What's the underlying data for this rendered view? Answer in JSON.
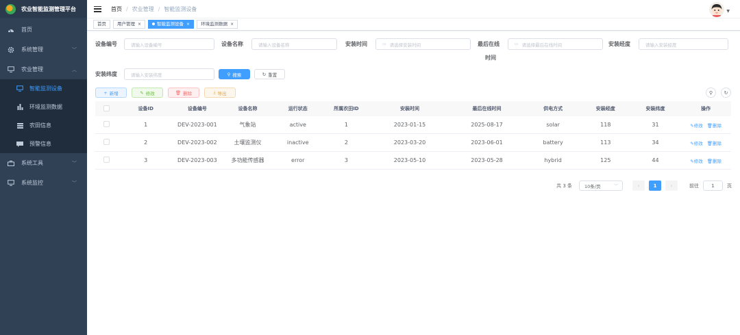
{
  "app": {
    "title": "农业智能监测管理平台"
  },
  "sidebar": {
    "items": [
      {
        "label": "首页",
        "icon": "dashboard-icon"
      },
      {
        "label": "系统管理",
        "icon": "gear-icon",
        "expandable": true
      },
      {
        "label": "农业管理",
        "icon": "monitor-icon",
        "expandable": true,
        "expanded": true
      },
      {
        "label": "系统工具",
        "icon": "toolbox-icon",
        "expandable": true
      },
      {
        "label": "系统监控",
        "icon": "monitor-icon",
        "expandable": true
      }
    ],
    "sub_items": [
      {
        "label": "智能监测设备",
        "icon": "monitor-icon",
        "active": true
      },
      {
        "label": "环境监测数据",
        "icon": "bar-chart-icon"
      },
      {
        "label": "农田信息",
        "icon": "grid-icon"
      },
      {
        "label": "预警信息",
        "icon": "message-icon"
      }
    ]
  },
  "breadcrumb": [
    "首页",
    "农业管理",
    "智能监测设备"
  ],
  "tags": [
    {
      "label": "首页",
      "closable": false,
      "active": false
    },
    {
      "label": "用户管理",
      "closable": true,
      "active": false
    },
    {
      "label": "智能监测设备",
      "closable": true,
      "active": true
    },
    {
      "label": "环境监测数据",
      "closable": true,
      "active": false
    }
  ],
  "search_form": {
    "device_code": {
      "label": "设备编号",
      "placeholder": "请输入设备编号"
    },
    "device_name": {
      "label": "设备名称",
      "placeholder": "请输入设备名称"
    },
    "install_time": {
      "label": "安装时间",
      "placeholder": "请选择安装时间"
    },
    "last_online": {
      "label_line1": "最后在线",
      "label_line2": "时间",
      "placeholder": "请选择最后在线时间"
    },
    "longitude": {
      "label": "安装经度",
      "placeholder": "请输入安装经度"
    },
    "latitude": {
      "label": "安装纬度",
      "placeholder": "请输入安装纬度"
    },
    "search_label": "搜索",
    "reset_label": "重置"
  },
  "toolbar": {
    "add_label": "新增",
    "edit_label": "修改",
    "delete_label": "删除",
    "export_label": "导出"
  },
  "table": {
    "headers": [
      "设备ID",
      "设备编号",
      "设备名称",
      "运行状态",
      "所属农田ID",
      "安装时间",
      "最后在线时间",
      "供电方式",
      "安装经度",
      "安装纬度",
      "操作"
    ],
    "rows": [
      [
        "1",
        "DEV-2023-001",
        "气象站",
        "active",
        "1",
        "2023-01-15",
        "2025-08-17",
        "solar",
        "118",
        "31"
      ],
      [
        "2",
        "DEV-2023-002",
        "土壤监测仪",
        "inactive",
        "2",
        "2023-03-20",
        "2023-06-01",
        "battery",
        "113",
        "34"
      ],
      [
        "3",
        "DEV-2023-003",
        "多功能传感器",
        "error",
        "3",
        "2023-05-10",
        "2023-05-28",
        "hybrid",
        "125",
        "44"
      ]
    ],
    "op_edit": "修改",
    "op_delete": "删除"
  },
  "pagination": {
    "total_text": "共 3 条",
    "page_size": "10条/页",
    "current_page": "1",
    "goto_label": "前往",
    "goto_value": "1",
    "page_unit": "页"
  },
  "colors": {
    "sidebar_bg": "#304156",
    "accent": "#409eff"
  }
}
